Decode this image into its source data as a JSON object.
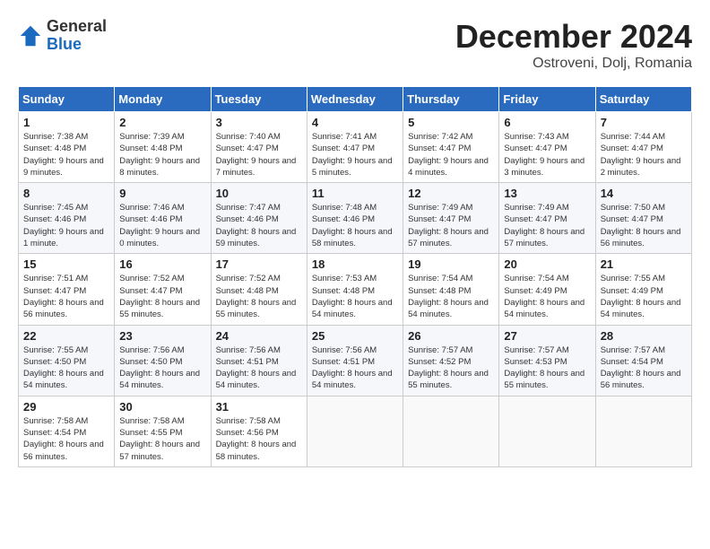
{
  "logo": {
    "general": "General",
    "blue": "Blue"
  },
  "header": {
    "month": "December 2024",
    "location": "Ostroveni, Dolj, Romania"
  },
  "weekdays": [
    "Sunday",
    "Monday",
    "Tuesday",
    "Wednesday",
    "Thursday",
    "Friday",
    "Saturday"
  ],
  "weeks": [
    [
      {
        "day": 1,
        "sunrise": "7:38 AM",
        "sunset": "4:48 PM",
        "daylight": "9 hours and 9 minutes."
      },
      {
        "day": 2,
        "sunrise": "7:39 AM",
        "sunset": "4:48 PM",
        "daylight": "9 hours and 8 minutes."
      },
      {
        "day": 3,
        "sunrise": "7:40 AM",
        "sunset": "4:47 PM",
        "daylight": "9 hours and 7 minutes."
      },
      {
        "day": 4,
        "sunrise": "7:41 AM",
        "sunset": "4:47 PM",
        "daylight": "9 hours and 5 minutes."
      },
      {
        "day": 5,
        "sunrise": "7:42 AM",
        "sunset": "4:47 PM",
        "daylight": "9 hours and 4 minutes."
      },
      {
        "day": 6,
        "sunrise": "7:43 AM",
        "sunset": "4:47 PM",
        "daylight": "9 hours and 3 minutes."
      },
      {
        "day": 7,
        "sunrise": "7:44 AM",
        "sunset": "4:47 PM",
        "daylight": "9 hours and 2 minutes."
      }
    ],
    [
      {
        "day": 8,
        "sunrise": "7:45 AM",
        "sunset": "4:46 PM",
        "daylight": "9 hours and 1 minute."
      },
      {
        "day": 9,
        "sunrise": "7:46 AM",
        "sunset": "4:46 PM",
        "daylight": "9 hours and 0 minutes."
      },
      {
        "day": 10,
        "sunrise": "7:47 AM",
        "sunset": "4:46 PM",
        "daylight": "8 hours and 59 minutes."
      },
      {
        "day": 11,
        "sunrise": "7:48 AM",
        "sunset": "4:46 PM",
        "daylight": "8 hours and 58 minutes."
      },
      {
        "day": 12,
        "sunrise": "7:49 AM",
        "sunset": "4:47 PM",
        "daylight": "8 hours and 57 minutes."
      },
      {
        "day": 13,
        "sunrise": "7:49 AM",
        "sunset": "4:47 PM",
        "daylight": "8 hours and 57 minutes."
      },
      {
        "day": 14,
        "sunrise": "7:50 AM",
        "sunset": "4:47 PM",
        "daylight": "8 hours and 56 minutes."
      }
    ],
    [
      {
        "day": 15,
        "sunrise": "7:51 AM",
        "sunset": "4:47 PM",
        "daylight": "8 hours and 56 minutes."
      },
      {
        "day": 16,
        "sunrise": "7:52 AM",
        "sunset": "4:47 PM",
        "daylight": "8 hours and 55 minutes."
      },
      {
        "day": 17,
        "sunrise": "7:52 AM",
        "sunset": "4:48 PM",
        "daylight": "8 hours and 55 minutes."
      },
      {
        "day": 18,
        "sunrise": "7:53 AM",
        "sunset": "4:48 PM",
        "daylight": "8 hours and 54 minutes."
      },
      {
        "day": 19,
        "sunrise": "7:54 AM",
        "sunset": "4:48 PM",
        "daylight": "8 hours and 54 minutes."
      },
      {
        "day": 20,
        "sunrise": "7:54 AM",
        "sunset": "4:49 PM",
        "daylight": "8 hours and 54 minutes."
      },
      {
        "day": 21,
        "sunrise": "7:55 AM",
        "sunset": "4:49 PM",
        "daylight": "8 hours and 54 minutes."
      }
    ],
    [
      {
        "day": 22,
        "sunrise": "7:55 AM",
        "sunset": "4:50 PM",
        "daylight": "8 hours and 54 minutes."
      },
      {
        "day": 23,
        "sunrise": "7:56 AM",
        "sunset": "4:50 PM",
        "daylight": "8 hours and 54 minutes."
      },
      {
        "day": 24,
        "sunrise": "7:56 AM",
        "sunset": "4:51 PM",
        "daylight": "8 hours and 54 minutes."
      },
      {
        "day": 25,
        "sunrise": "7:56 AM",
        "sunset": "4:51 PM",
        "daylight": "8 hours and 54 minutes."
      },
      {
        "day": 26,
        "sunrise": "7:57 AM",
        "sunset": "4:52 PM",
        "daylight": "8 hours and 55 minutes."
      },
      {
        "day": 27,
        "sunrise": "7:57 AM",
        "sunset": "4:53 PM",
        "daylight": "8 hours and 55 minutes."
      },
      {
        "day": 28,
        "sunrise": "7:57 AM",
        "sunset": "4:54 PM",
        "daylight": "8 hours and 56 minutes."
      }
    ],
    [
      {
        "day": 29,
        "sunrise": "7:58 AM",
        "sunset": "4:54 PM",
        "daylight": "8 hours and 56 minutes."
      },
      {
        "day": 30,
        "sunrise": "7:58 AM",
        "sunset": "4:55 PM",
        "daylight": "8 hours and 57 minutes."
      },
      {
        "day": 31,
        "sunrise": "7:58 AM",
        "sunset": "4:56 PM",
        "daylight": "8 hours and 58 minutes."
      },
      null,
      null,
      null,
      null
    ]
  ]
}
